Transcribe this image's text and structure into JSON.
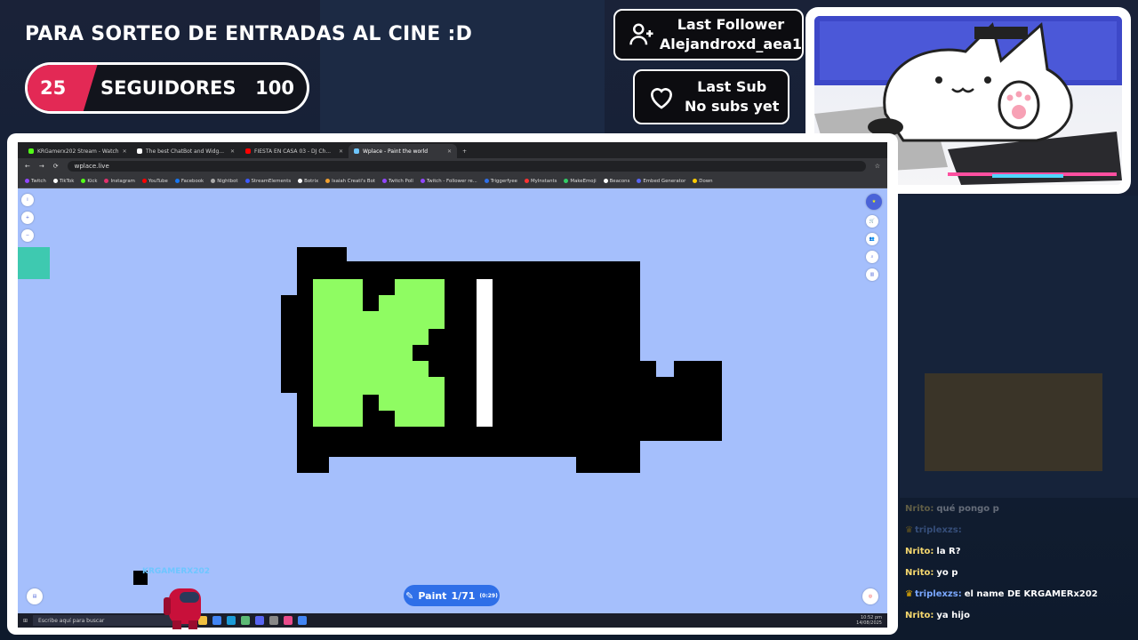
{
  "overlay": {
    "title": "PARA SORTEO DE ENTRADAS AL CINE :D",
    "goal": {
      "current": "25",
      "label": "SEGUIDORES",
      "target": "100",
      "progress_fraction": 0.25,
      "fill_color": "#e32955"
    },
    "last_follower": {
      "heading": "Last Follower",
      "name": "Alejandroxd_aea1",
      "icon": "user-plus-icon"
    },
    "last_sub": {
      "heading": "Last Sub",
      "name": "No subs yet",
      "icon": "heart-icon"
    },
    "streamer_tag": "KRGAMERX202"
  },
  "browser": {
    "tabs": [
      {
        "label": "KRGamerx202 Stream - Watch",
        "color": "#53fc18",
        "active": false
      },
      {
        "label": "The best ChatBot and Widg...",
        "color": "#ffffff",
        "active": false
      },
      {
        "label": "FIESTA EN CASA 03 - DJ Ch...",
        "color": "#ff0000",
        "active": false
      },
      {
        "label": "Wplace - Paint the world",
        "color": "#6ec6ff",
        "active": true
      }
    ],
    "url": "wplace.live",
    "bookmarks": [
      {
        "label": "Twitch",
        "color": "#9146ff"
      },
      {
        "label": "TikTok",
        "color": "#ffffff"
      },
      {
        "label": "Kick",
        "color": "#53fc18"
      },
      {
        "label": "Instagram",
        "color": "#e1306c"
      },
      {
        "label": "YouTube",
        "color": "#ff0000"
      },
      {
        "label": "Facebook",
        "color": "#1877f2"
      },
      {
        "label": "Nightbot",
        "color": "#aaaaaa"
      },
      {
        "label": "StreamElements",
        "color": "#3d5afe"
      },
      {
        "label": "Botrix",
        "color": "#ffffff"
      },
      {
        "label": "Isaiah Creati's Bot",
        "color": "#f0a030"
      },
      {
        "label": "Twitch Poll",
        "color": "#9146ff"
      },
      {
        "label": "Twitch - Follower re...",
        "color": "#9146ff"
      },
      {
        "label": "Triggerfyee",
        "color": "#2f6fe8"
      },
      {
        "label": "MyInstants",
        "color": "#ff3333"
      },
      {
        "label": "MakeEmoji",
        "color": "#33cc66"
      },
      {
        "label": "Beacons",
        "color": "#ffffff"
      },
      {
        "label": "Embed Generator",
        "color": "#5865f2"
      },
      {
        "label": "Down",
        "color": "#ffcc00"
      }
    ],
    "paint_button": {
      "label": "Paint",
      "count": "1/71",
      "timer": "(0:29)"
    },
    "taskbar": {
      "search_placeholder": "Escribe aquí para buscar",
      "time": "10:52 pm",
      "date": "14/08/2025"
    }
  },
  "chat": [
    {
      "user": "Nrito:",
      "text": "qué pongo p",
      "faded": true,
      "crown": false
    },
    {
      "user": "triplexzs:",
      "text": "",
      "faded": true,
      "crown": true
    },
    {
      "user": "Nrito:",
      "text": "la R?",
      "faded": false,
      "crown": false
    },
    {
      "user": "Nrito:",
      "text": "yo p",
      "faded": false,
      "crown": false
    },
    {
      "user": "triplexzs:",
      "text": "el name DE KRGAMERx202",
      "faded": false,
      "crown": true
    },
    {
      "user": "Nrito:",
      "text": "ya hijo",
      "faded": false,
      "crown": false
    }
  ]
}
